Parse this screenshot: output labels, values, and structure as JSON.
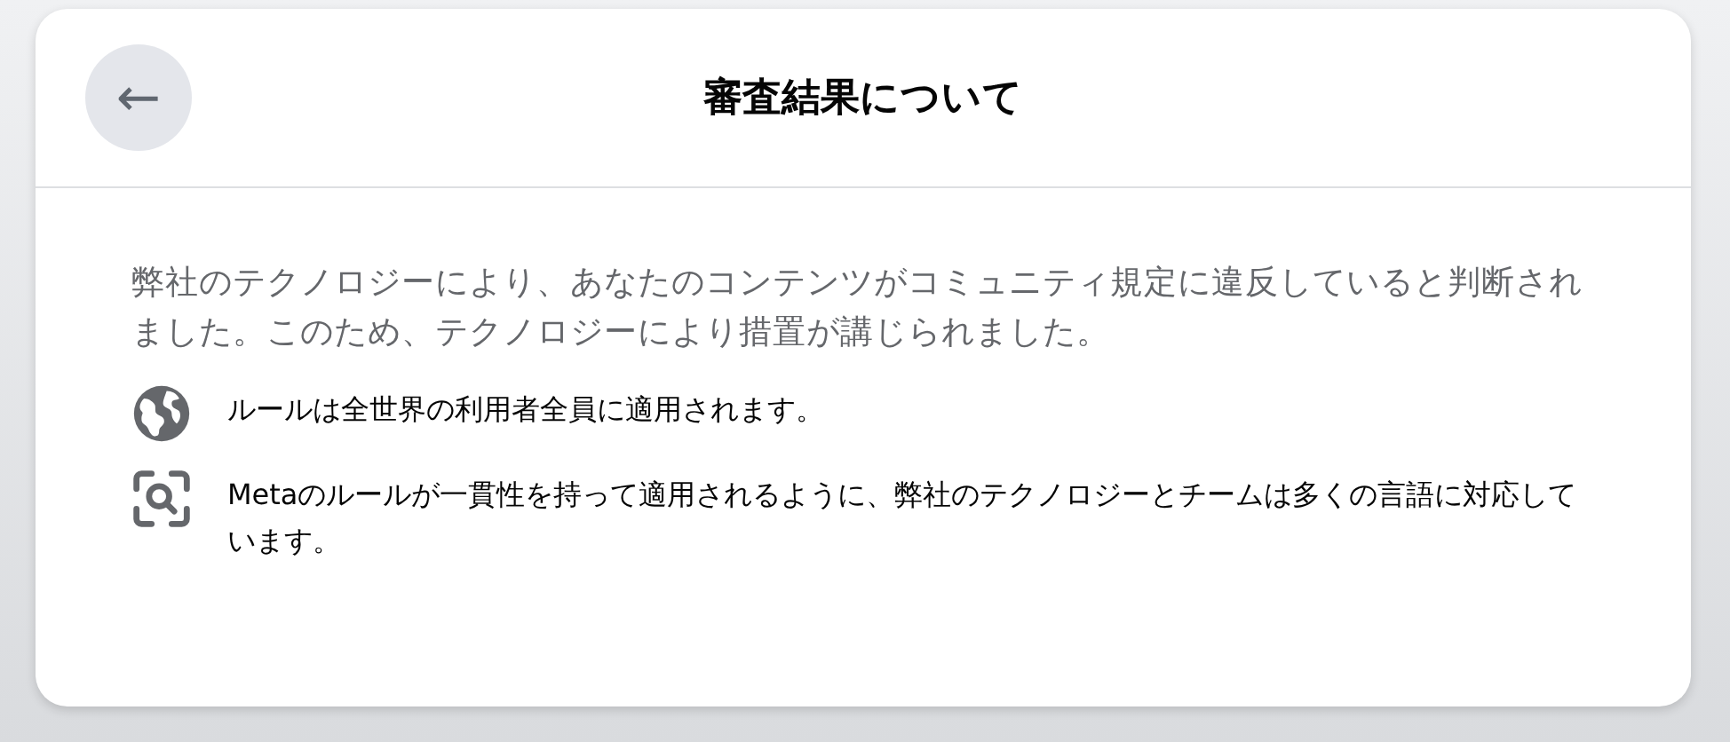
{
  "header": {
    "title": "審査結果について",
    "back_button": {
      "label": "←"
    }
  },
  "intro": "弊社のテクノロジーにより、あなたのコンテンツがコミュニティ規定に違反していると判断されました。このため、テクノロジーにより措置が講じられました。",
  "items": [
    {
      "kind": "globe",
      "text": "ルールは全世界の利用者全員に適用されます。"
    },
    {
      "kind": "scan",
      "text": "Metaのルールが一貫性を持って適用されるように、弊社のテクノロジーとチームは多くの言語に対応しています。"
    }
  ]
}
